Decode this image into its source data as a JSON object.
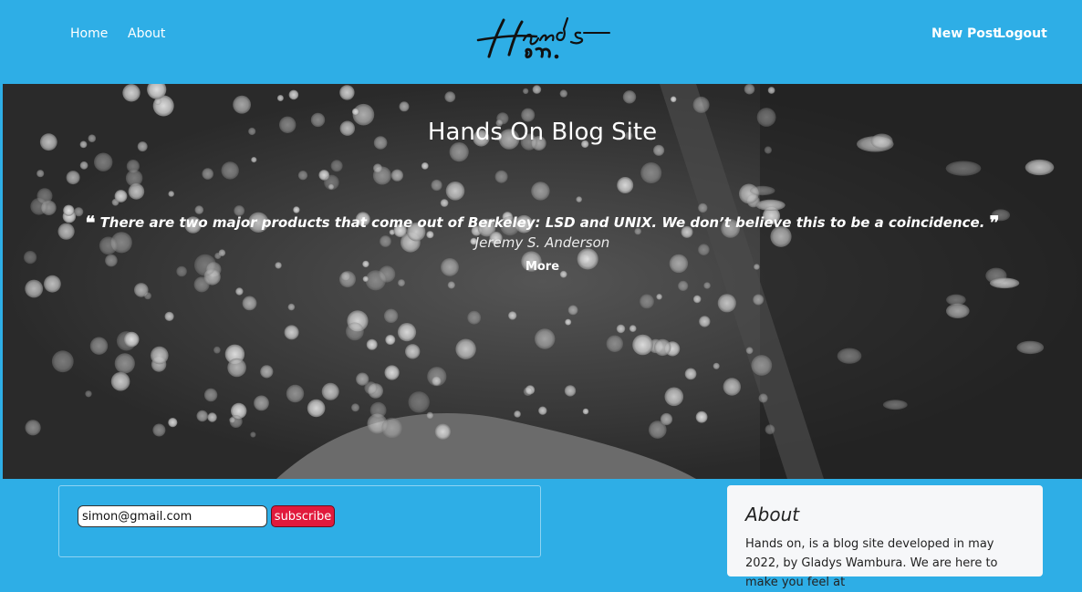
{
  "nav": {
    "home_label": "Home",
    "about_label": "About",
    "new_post_label": "New Post",
    "logout_label": "Logout",
    "logo_alt": "Hands on."
  },
  "hero": {
    "title": "Hands On Blog Site",
    "quote": "There are two major products that come out of Berkeley: LSD and UNIX. We don’t believe this to be a coincidence.",
    "open_quote": "❝",
    "close_quote": "❞",
    "author": "Jeremy S. Anderson",
    "more_label": "More"
  },
  "subscribe": {
    "email_value": "simon@gmail.com",
    "button_label": "subscribe"
  },
  "about": {
    "title": "About",
    "text": "Hands on, is a blog site developed in may 2022, by Gladys Wambura. We are here to make you feel at"
  },
  "colors": {
    "background": "#2eaee6",
    "subscribe_button": "#e11a3c",
    "card": "#f6f7f9"
  }
}
